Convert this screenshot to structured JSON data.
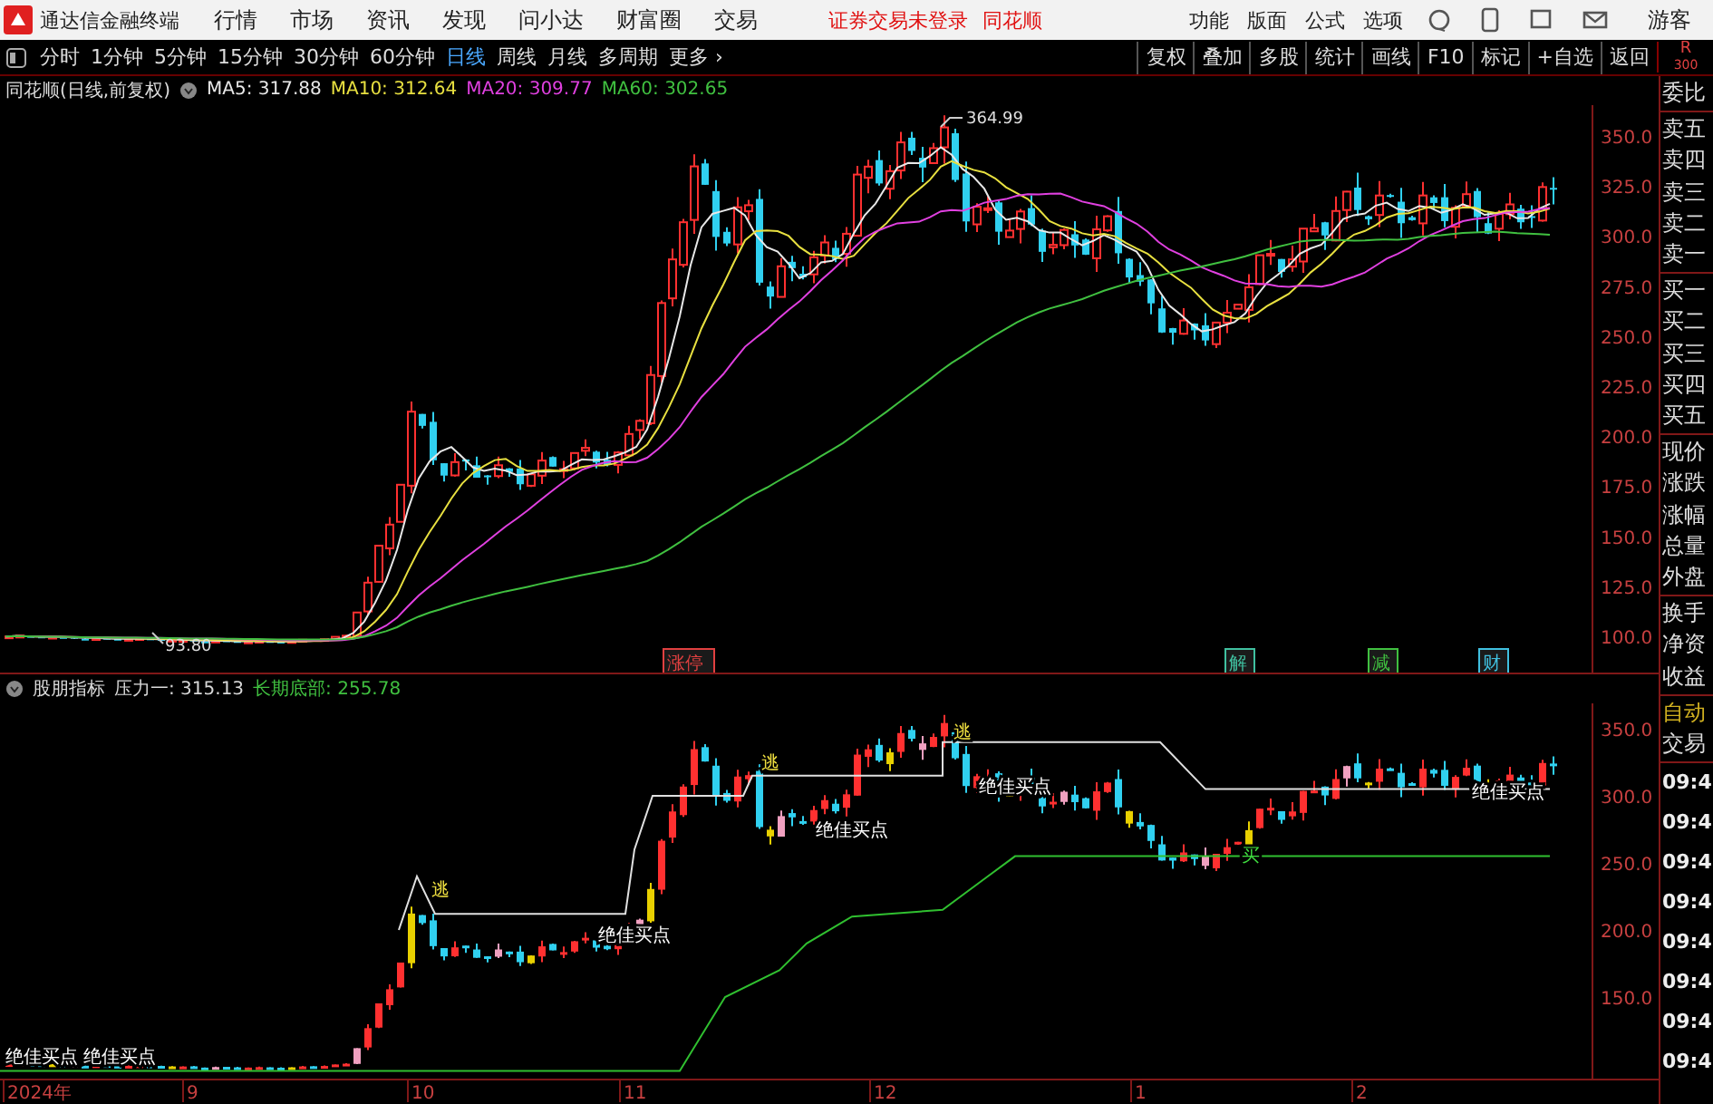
{
  "app": {
    "title": "通达信金融终端",
    "menu": [
      "行情",
      "市场",
      "资讯",
      "发现",
      "问小达",
      "财富圈",
      "交易"
    ],
    "notice": "证券交易未登录",
    "broker": "同花顺",
    "tools": [
      "功能",
      "版面",
      "公式",
      "选项"
    ],
    "user": "游客"
  },
  "toolbar": {
    "periods": [
      {
        "label": "分时",
        "selected": false
      },
      {
        "label": "1分钟",
        "selected": false
      },
      {
        "label": "5分钟",
        "selected": false
      },
      {
        "label": "15分钟",
        "selected": false
      },
      {
        "label": "30分钟",
        "selected": false
      },
      {
        "label": "60分钟",
        "selected": false
      },
      {
        "label": "日线",
        "selected": true
      },
      {
        "label": "周线",
        "selected": false
      },
      {
        "label": "月线",
        "selected": false
      },
      {
        "label": "多周期",
        "selected": false
      }
    ],
    "more": "更多 ›",
    "actions": [
      "复权",
      "叠加",
      "多股",
      "统计",
      "画线",
      "F10",
      "标记",
      "+自选",
      "返回"
    ],
    "corner": [
      "R",
      "300"
    ]
  },
  "main_chart": {
    "title": "同花顺(日线,前复权)",
    "indicators": [
      {
        "label": "MA5: 317.88",
        "color": "#e8e8e8"
      },
      {
        "label": "MA10: 312.64",
        "color": "#e8e040"
      },
      {
        "label": "MA20: 309.77",
        "color": "#e040e0"
      },
      {
        "label": "MA60: 302.65",
        "color": "#40c040"
      }
    ],
    "high_label": "364.99",
    "low_label": "93.80",
    "price_axis": [
      "350.0",
      "325.0",
      "300.0",
      "275.0",
      "250.0",
      "225.0",
      "200.0",
      "175.0",
      "150.0",
      "125.0",
      "100.0"
    ],
    "event_tags": [
      {
        "label": "涨停",
        "color": "#e04040"
      },
      {
        "label": "解",
        "color": "#40c0a0"
      },
      {
        "label": "减",
        "color": "#40c040"
      },
      {
        "label": "财",
        "color": "#40c0e0"
      }
    ]
  },
  "indicator_chart": {
    "title": "股朋指标",
    "values": [
      {
        "label": "压力一: 315.13",
        "color": "#d8d8d8"
      },
      {
        "label": "长期底部: 255.78",
        "color": "#40c040"
      }
    ],
    "price_axis": [
      "350.0",
      "300.0",
      "250.0",
      "200.0",
      "150.0"
    ],
    "signals": [
      {
        "label": "逃",
        "kind": "escape"
      },
      {
        "label": "逃",
        "kind": "escape"
      },
      {
        "label": "逃",
        "kind": "escape"
      },
      {
        "label": "绝佳买点",
        "kind": "best_buy"
      },
      {
        "label": "绝佳买点",
        "kind": "best_buy"
      },
      {
        "label": "绝佳买点",
        "kind": "best_buy"
      },
      {
        "label": "绝佳买点",
        "kind": "best_buy"
      },
      {
        "label": "绝佳买点",
        "kind": "best_buy"
      },
      {
        "label": "绝佳买点",
        "kind": "best_buy"
      },
      {
        "label": "买",
        "kind": "buy"
      }
    ]
  },
  "date_axis": [
    "2024年",
    "9",
    "10",
    "11",
    "12",
    "1",
    "2"
  ],
  "side_panel": {
    "sections": [
      [
        "委比"
      ],
      [
        "卖五",
        "卖四",
        "卖三",
        "卖二",
        "卖一"
      ],
      [
        "买一",
        "买二",
        "买三",
        "买四",
        "买五"
      ],
      [
        "现价",
        "涨跌",
        "涨幅",
        "总量",
        "外盘"
      ],
      [
        "换手",
        "净资",
        "收益"
      ]
    ],
    "auto": [
      "自动",
      "交易"
    ],
    "times": [
      "09:4",
      "09:4",
      "09:4",
      "09:4",
      "09:4",
      "09:4",
      "09:4",
      "09:4"
    ]
  }
}
